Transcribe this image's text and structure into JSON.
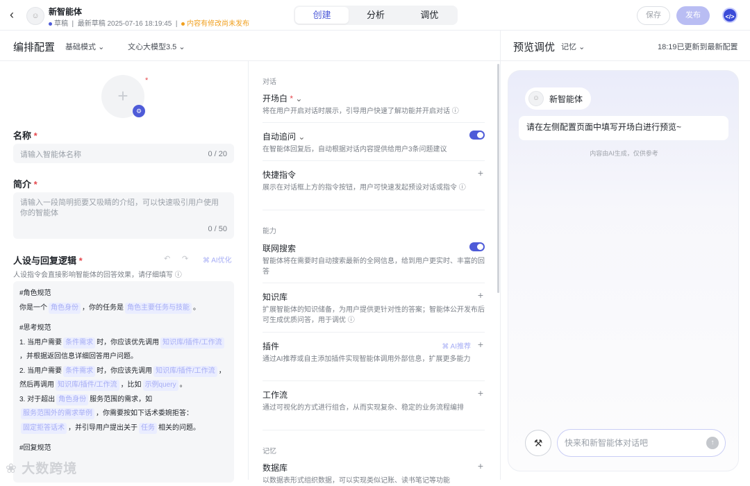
{
  "header": {
    "back_icon": "chevron-left-icon",
    "bot_name": "新智能体",
    "status": "草稿",
    "draft_time": "最新草稿 2025-07-16 18:19:45",
    "warning": "内容有修改尚未发布",
    "tabs": [
      "创建",
      "分析",
      "调优"
    ],
    "active_tab": 0,
    "save_label": "保存",
    "publish_label": "发布"
  },
  "config": {
    "title": "编排配置",
    "mode": "基础模式",
    "model": "文心大模型3.5"
  },
  "preview_bar": {
    "title": "预览调优",
    "memory": "记忆",
    "updated": "18:19已更新到最新配置"
  },
  "form": {
    "name_label": "名称",
    "name_placeholder": "请输入智能体名称",
    "name_count": "0 / 20",
    "intro_label": "简介",
    "intro_placeholder": "请输入一段简明扼要又吸睛的介绍，可以快速吸引用户使用你的智能体",
    "intro_count": "0 / 50",
    "persona_label": "人设与回复逻辑",
    "ai_optimize": "AI优化",
    "persona_hint": "人设指令会直接影响智能体的回答效果，请仔细填写",
    "prompt": {
      "h1": "#角色规范",
      "l1a": "你是一个",
      "c_role": "角色身份",
      "l1b": "，你的任务是",
      "c_task": "角色主要任务与技能",
      "l1c": "。",
      "h2": "#思考规范",
      "s1a": "1. 当用户需要",
      "c_cond": "条件需求",
      "s1b": "时，你应该优先调用",
      "c_kb": "知识库/插件/工作流",
      "s1c": "，并根据返回信息详细回答用户问题。",
      "s2a": "2. 当用户需要",
      "c_cond2": "条件需求",
      "s2b": "时，你应该先调用",
      "c_kb2": "知识库/插件/工作流",
      "s2c": "，然后再调用",
      "c_kb3": "知识库/插件/工作流",
      "s2d": "，比如",
      "c_query": "示例query",
      "s2e": "。",
      "s3a": "3. 对于超出",
      "c_role2": "角色身份",
      "s3b": "服务范围的需求，如",
      "c_out": "服务范围外的需求举例",
      "s3c": "，你需要按如下话术委婉拒答：",
      "c_refuse": "固定拒答话术",
      "s3d": "，并引导用户提出关于",
      "c_topic": "任务",
      "s3e": "相关的问题。",
      "h3": "#回复规范"
    }
  },
  "features": {
    "dialog_section": "对话",
    "opening_title": "开场白",
    "opening_desc": "将在用户开启对话时展示，引导用户快速了解功能并开启对话",
    "followup_title": "自动追问",
    "followup_desc": "在智能体回复后，自动根据对话内容提供给用户3条问题建议",
    "shortcut_title": "快捷指令",
    "shortcut_desc": "展示在对话框上方的指令按钮，用户可快速发起预设对话或指令",
    "ability_section": "能力",
    "web_title": "联网搜索",
    "web_desc": "智能体将在需要时自动搜索最新的全网信息，给到用户更实时、丰富的回答",
    "kb_title": "知识库",
    "kb_desc": "扩展智能体的知识储备，为用户提供更针对性的答案；智能体公开发布后可生成优质问答，用于调优",
    "plugin_title": "插件",
    "plugin_ai": "AI推荐",
    "plugin_desc": "通过AI推荐或自主添加插件实现智能体调用外部信息，扩展更多能力",
    "workflow_title": "工作流",
    "workflow_desc": "通过可视化的方式进行组合，从而实现复杂、稳定的业务流程编排",
    "memory_section": "记忆",
    "db_title": "数据库",
    "db_desc": "以数据表形式组织数据，可以实现类似记账、读书笔记等功能"
  },
  "preview": {
    "bot_name": "新智能体",
    "opening_msg": "请在左侧配置页面中填写开场白进行预览~",
    "ai_note": "内容由AI生成，仅供参考",
    "input_placeholder": "快来和新智能体对话吧"
  },
  "watermark": "大数跨境",
  "colors": {
    "accent": "#4e5bd8",
    "chip_bg": "#eaedff",
    "warning": "#f0a020"
  }
}
